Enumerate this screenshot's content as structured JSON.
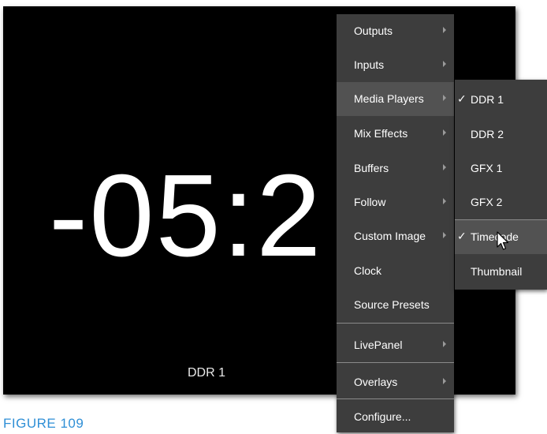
{
  "monitor": {
    "timecode": "-05:2",
    "label": "DDR 1"
  },
  "caption": "FIGURE 109",
  "main_menu": {
    "items": [
      {
        "label": "Outputs",
        "submenu": true
      },
      {
        "label": "Inputs",
        "submenu": true
      },
      {
        "label": "Media Players",
        "submenu": true,
        "highlighted": true
      },
      {
        "label": "Mix Effects",
        "submenu": true
      },
      {
        "label": "Buffers",
        "submenu": true
      },
      {
        "label": "Follow",
        "submenu": true
      },
      {
        "label": "Custom Image",
        "submenu": true
      },
      {
        "label": "Clock",
        "submenu": false
      },
      {
        "label": "Source Presets",
        "submenu": false
      },
      {
        "label": "LivePanel",
        "submenu": true
      },
      {
        "label": "Overlays",
        "submenu": true
      },
      {
        "label": "Configure...",
        "submenu": false
      }
    ]
  },
  "sub_menu": {
    "check_glyph": "✓",
    "items": [
      {
        "label": "DDR 1",
        "checked": true
      },
      {
        "label": "DDR 2",
        "checked": false
      },
      {
        "label": "GFX 1",
        "checked": false
      },
      {
        "label": "GFX 2",
        "checked": false
      },
      {
        "label": "Timecode",
        "checked": true,
        "highlighted": true
      },
      {
        "label": "Thumbnail",
        "checked": false
      }
    ]
  },
  "colors": {
    "monitor_bg": "#000000",
    "menu_bg": "#3d3d3d",
    "menu_highlight": "#525252",
    "caption": "#2f8fd6"
  },
  "icons": {
    "cursor": "arrow-pointer-icon",
    "submenu_arrow": "triangle-right-icon",
    "check": "checkmark-icon"
  }
}
